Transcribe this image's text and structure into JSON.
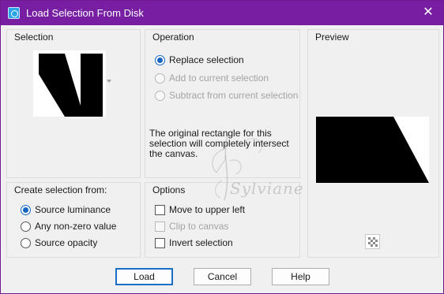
{
  "window": {
    "title": "Load Selection From Disk",
    "titlebar_color": "#781ea3",
    "app_icon": "selection-app-icon",
    "close_glyph": "✕"
  },
  "selection": {
    "title": "Selection"
  },
  "operation": {
    "title": "Operation",
    "options": [
      {
        "label": "Replace selection",
        "checked": true,
        "enabled": true
      },
      {
        "label": "Add to current selection",
        "checked": false,
        "enabled": false
      },
      {
        "label": "Subtract from current selection",
        "checked": false,
        "enabled": false
      }
    ],
    "info": "The original rectangle for this selection will completely intersect the canvas."
  },
  "preview": {
    "title": "Preview",
    "toggle_icon": "checkerboard-icon"
  },
  "create_from": {
    "title": "Create selection from:",
    "options": [
      {
        "label": "Source luminance",
        "checked": true
      },
      {
        "label": "Any non-zero value",
        "checked": false
      },
      {
        "label": "Source opacity",
        "checked": false
      }
    ]
  },
  "options": {
    "title": "Options",
    "items": [
      {
        "label": "Move to upper left",
        "checked": false,
        "enabled": true
      },
      {
        "label": "Clip to canvas",
        "checked": false,
        "enabled": false
      },
      {
        "label": "Invert selection",
        "checked": false,
        "enabled": true
      }
    ]
  },
  "buttons": {
    "load": "Load",
    "cancel": "Cancel",
    "help": "Help"
  },
  "watermark": {
    "text": "Sylviane"
  },
  "colors": {
    "accent": "#1565c0",
    "dialog_bg": "#f0f0f0"
  }
}
